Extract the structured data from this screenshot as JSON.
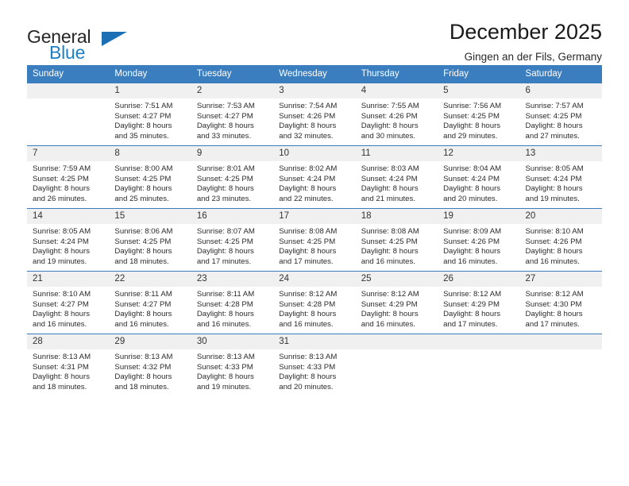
{
  "brand": {
    "name_part1": "General",
    "name_part2": "Blue",
    "flag_icon": "triangle-flag-icon"
  },
  "header": {
    "title": "December 2025",
    "subtitle": "Gingen an der Fils, Germany"
  },
  "theme": {
    "header_blue": "#3a7ebf",
    "daynum_gray": "#f0f0f0",
    "brand_blue": "#1f7fc4",
    "text": "#2b2b2b"
  },
  "calendar": {
    "weekday_headers": [
      "Sunday",
      "Monday",
      "Tuesday",
      "Wednesday",
      "Thursday",
      "Friday",
      "Saturday"
    ],
    "weeks": [
      [
        {
          "day": "",
          "empty": true,
          "sunrise": "",
          "sunset": "",
          "daylight_line1": "",
          "daylight_line2": ""
        },
        {
          "day": "1",
          "sunrise": "Sunrise: 7:51 AM",
          "sunset": "Sunset: 4:27 PM",
          "daylight_line1": "Daylight: 8 hours",
          "daylight_line2": "and 35 minutes."
        },
        {
          "day": "2",
          "sunrise": "Sunrise: 7:53 AM",
          "sunset": "Sunset: 4:27 PM",
          "daylight_line1": "Daylight: 8 hours",
          "daylight_line2": "and 33 minutes."
        },
        {
          "day": "3",
          "sunrise": "Sunrise: 7:54 AM",
          "sunset": "Sunset: 4:26 PM",
          "daylight_line1": "Daylight: 8 hours",
          "daylight_line2": "and 32 minutes."
        },
        {
          "day": "4",
          "sunrise": "Sunrise: 7:55 AM",
          "sunset": "Sunset: 4:26 PM",
          "daylight_line1": "Daylight: 8 hours",
          "daylight_line2": "and 30 minutes."
        },
        {
          "day": "5",
          "sunrise": "Sunrise: 7:56 AM",
          "sunset": "Sunset: 4:25 PM",
          "daylight_line1": "Daylight: 8 hours",
          "daylight_line2": "and 29 minutes."
        },
        {
          "day": "6",
          "sunrise": "Sunrise: 7:57 AM",
          "sunset": "Sunset: 4:25 PM",
          "daylight_line1": "Daylight: 8 hours",
          "daylight_line2": "and 27 minutes."
        }
      ],
      [
        {
          "day": "7",
          "sunrise": "Sunrise: 7:59 AM",
          "sunset": "Sunset: 4:25 PM",
          "daylight_line1": "Daylight: 8 hours",
          "daylight_line2": "and 26 minutes."
        },
        {
          "day": "8",
          "sunrise": "Sunrise: 8:00 AM",
          "sunset": "Sunset: 4:25 PM",
          "daylight_line1": "Daylight: 8 hours",
          "daylight_line2": "and 25 minutes."
        },
        {
          "day": "9",
          "sunrise": "Sunrise: 8:01 AM",
          "sunset": "Sunset: 4:25 PM",
          "daylight_line1": "Daylight: 8 hours",
          "daylight_line2": "and 23 minutes."
        },
        {
          "day": "10",
          "sunrise": "Sunrise: 8:02 AM",
          "sunset": "Sunset: 4:24 PM",
          "daylight_line1": "Daylight: 8 hours",
          "daylight_line2": "and 22 minutes."
        },
        {
          "day": "11",
          "sunrise": "Sunrise: 8:03 AM",
          "sunset": "Sunset: 4:24 PM",
          "daylight_line1": "Daylight: 8 hours",
          "daylight_line2": "and 21 minutes."
        },
        {
          "day": "12",
          "sunrise": "Sunrise: 8:04 AM",
          "sunset": "Sunset: 4:24 PM",
          "daylight_line1": "Daylight: 8 hours",
          "daylight_line2": "and 20 minutes."
        },
        {
          "day": "13",
          "sunrise": "Sunrise: 8:05 AM",
          "sunset": "Sunset: 4:24 PM",
          "daylight_line1": "Daylight: 8 hours",
          "daylight_line2": "and 19 minutes."
        }
      ],
      [
        {
          "day": "14",
          "sunrise": "Sunrise: 8:05 AM",
          "sunset": "Sunset: 4:24 PM",
          "daylight_line1": "Daylight: 8 hours",
          "daylight_line2": "and 19 minutes."
        },
        {
          "day": "15",
          "sunrise": "Sunrise: 8:06 AM",
          "sunset": "Sunset: 4:25 PM",
          "daylight_line1": "Daylight: 8 hours",
          "daylight_line2": "and 18 minutes."
        },
        {
          "day": "16",
          "sunrise": "Sunrise: 8:07 AM",
          "sunset": "Sunset: 4:25 PM",
          "daylight_line1": "Daylight: 8 hours",
          "daylight_line2": "and 17 minutes."
        },
        {
          "day": "17",
          "sunrise": "Sunrise: 8:08 AM",
          "sunset": "Sunset: 4:25 PM",
          "daylight_line1": "Daylight: 8 hours",
          "daylight_line2": "and 17 minutes."
        },
        {
          "day": "18",
          "sunrise": "Sunrise: 8:08 AM",
          "sunset": "Sunset: 4:25 PM",
          "daylight_line1": "Daylight: 8 hours",
          "daylight_line2": "and 16 minutes."
        },
        {
          "day": "19",
          "sunrise": "Sunrise: 8:09 AM",
          "sunset": "Sunset: 4:26 PM",
          "daylight_line1": "Daylight: 8 hours",
          "daylight_line2": "and 16 minutes."
        },
        {
          "day": "20",
          "sunrise": "Sunrise: 8:10 AM",
          "sunset": "Sunset: 4:26 PM",
          "daylight_line1": "Daylight: 8 hours",
          "daylight_line2": "and 16 minutes."
        }
      ],
      [
        {
          "day": "21",
          "sunrise": "Sunrise: 8:10 AM",
          "sunset": "Sunset: 4:27 PM",
          "daylight_line1": "Daylight: 8 hours",
          "daylight_line2": "and 16 minutes."
        },
        {
          "day": "22",
          "sunrise": "Sunrise: 8:11 AM",
          "sunset": "Sunset: 4:27 PM",
          "daylight_line1": "Daylight: 8 hours",
          "daylight_line2": "and 16 minutes."
        },
        {
          "day": "23",
          "sunrise": "Sunrise: 8:11 AM",
          "sunset": "Sunset: 4:28 PM",
          "daylight_line1": "Daylight: 8 hours",
          "daylight_line2": "and 16 minutes."
        },
        {
          "day": "24",
          "sunrise": "Sunrise: 8:12 AM",
          "sunset": "Sunset: 4:28 PM",
          "daylight_line1": "Daylight: 8 hours",
          "daylight_line2": "and 16 minutes."
        },
        {
          "day": "25",
          "sunrise": "Sunrise: 8:12 AM",
          "sunset": "Sunset: 4:29 PM",
          "daylight_line1": "Daylight: 8 hours",
          "daylight_line2": "and 16 minutes."
        },
        {
          "day": "26",
          "sunrise": "Sunrise: 8:12 AM",
          "sunset": "Sunset: 4:29 PM",
          "daylight_line1": "Daylight: 8 hours",
          "daylight_line2": "and 17 minutes."
        },
        {
          "day": "27",
          "sunrise": "Sunrise: 8:12 AM",
          "sunset": "Sunset: 4:30 PM",
          "daylight_line1": "Daylight: 8 hours",
          "daylight_line2": "and 17 minutes."
        }
      ],
      [
        {
          "day": "28",
          "sunrise": "Sunrise: 8:13 AM",
          "sunset": "Sunset: 4:31 PM",
          "daylight_line1": "Daylight: 8 hours",
          "daylight_line2": "and 18 minutes."
        },
        {
          "day": "29",
          "sunrise": "Sunrise: 8:13 AM",
          "sunset": "Sunset: 4:32 PM",
          "daylight_line1": "Daylight: 8 hours",
          "daylight_line2": "and 18 minutes."
        },
        {
          "day": "30",
          "sunrise": "Sunrise: 8:13 AM",
          "sunset": "Sunset: 4:33 PM",
          "daylight_line1": "Daylight: 8 hours",
          "daylight_line2": "and 19 minutes."
        },
        {
          "day": "31",
          "sunrise": "Sunrise: 8:13 AM",
          "sunset": "Sunset: 4:33 PM",
          "daylight_line1": "Daylight: 8 hours",
          "daylight_line2": "and 20 minutes."
        },
        {
          "day": "",
          "empty": true,
          "sunrise": "",
          "sunset": "",
          "daylight_line1": "",
          "daylight_line2": ""
        },
        {
          "day": "",
          "empty": true,
          "sunrise": "",
          "sunset": "",
          "daylight_line1": "",
          "daylight_line2": ""
        },
        {
          "day": "",
          "empty": true,
          "sunrise": "",
          "sunset": "",
          "daylight_line1": "",
          "daylight_line2": ""
        }
      ]
    ]
  }
}
